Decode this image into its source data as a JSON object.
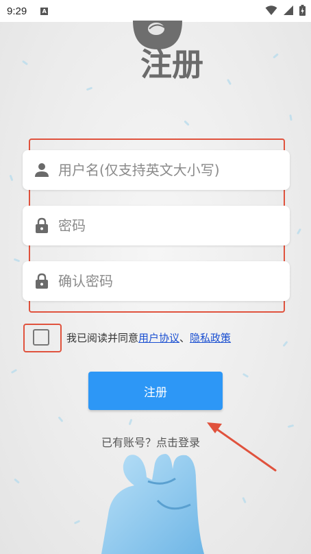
{
  "status_bar": {
    "time": "9:29",
    "notification_icon": "A"
  },
  "header": {
    "logo_text": "注册"
  },
  "form": {
    "username_placeholder": "用户名(仅支持英文大小写)",
    "password_placeholder": "密码",
    "confirm_placeholder": "确认密码"
  },
  "agreement": {
    "prefix": "我已阅读并同意",
    "user_agreement": "用户协议",
    "separator": "、",
    "privacy_policy": "隐私政策",
    "checked": false
  },
  "actions": {
    "register_label": "注册",
    "login_prompt": "已有账号？点击登录"
  },
  "colors": {
    "accent": "#2d97f6",
    "annotation": "#e0523d",
    "link": "#1a4fd1"
  }
}
